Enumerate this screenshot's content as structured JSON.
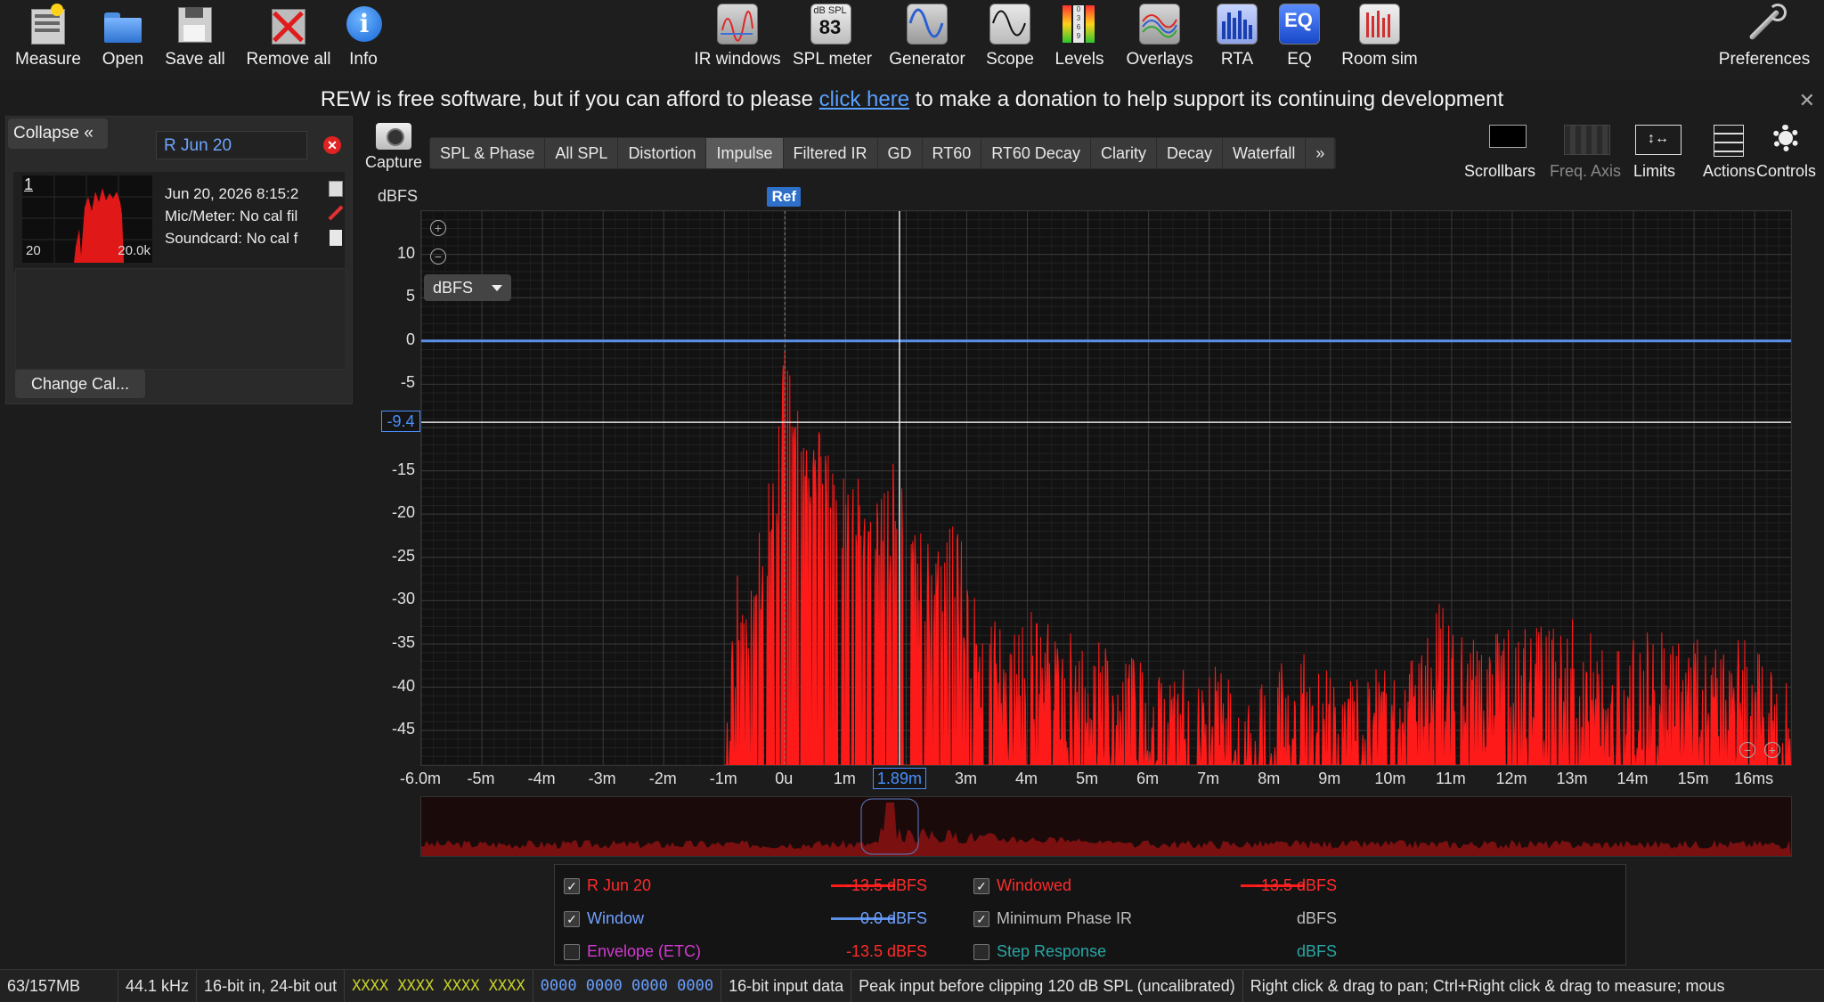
{
  "toolbar": {
    "left": [
      {
        "id": "measure",
        "label": "Measure",
        "icon": "measure-icon"
      },
      {
        "id": "open",
        "label": "Open",
        "icon": "folder-icon"
      },
      {
        "id": "save_all",
        "label": "Save all",
        "icon": "floppy-disk-icon"
      },
      {
        "id": "remove_all",
        "label": "Remove all",
        "icon": "remove-all-icon"
      },
      {
        "id": "info",
        "label": "Info",
        "icon": "info-icon"
      }
    ],
    "right": [
      {
        "id": "ir_windows",
        "label": "IR windows",
        "icon": "ir-windows-icon"
      },
      {
        "id": "spl_meter",
        "label": "SPL meter",
        "icon": "spl-meter-icon",
        "icon_text": "dB SPL",
        "icon_value": "83"
      },
      {
        "id": "generator",
        "label": "Generator",
        "icon": "sine-wave-icon"
      },
      {
        "id": "scope",
        "label": "Scope",
        "icon": "scope-icon"
      },
      {
        "id": "levels",
        "label": "Levels",
        "icon": "levels-icon"
      },
      {
        "id": "overlays",
        "label": "Overlays",
        "icon": "overlays-icon"
      },
      {
        "id": "rta",
        "label": "RTA",
        "icon": "rta-bars-icon"
      },
      {
        "id": "eq",
        "label": "EQ",
        "icon": "eq-icon",
        "icon_text": "EQ"
      },
      {
        "id": "room_sim",
        "label": "Room sim",
        "icon": "room-sim-icon"
      }
    ],
    "preferences": "Preferences"
  },
  "banner": {
    "before": "REW is free software, but if you can afford to please ",
    "link": "click here",
    "after": " to make a donation to help support its continuing development",
    "close": "✕"
  },
  "measurements_panel": {
    "collapse_label": "Collapse",
    "collapse_glyph": "«",
    "name": "R Jun 20",
    "index": "1",
    "thumb_left": "20",
    "thumb_right": "20.0k",
    "info_lines": [
      "Jun 20, 2026 8:15:2",
      "Mic/Meter: No cal fil",
      "Soundcard: No cal f"
    ],
    "change_cal": "Change Cal..."
  },
  "graph": {
    "capture_label": "Capture",
    "tabs": [
      {
        "label": "SPL & Phase",
        "active": false
      },
      {
        "label": "All SPL",
        "active": false
      },
      {
        "label": "Distortion",
        "active": false
      },
      {
        "label": "Impulse",
        "active": true
      },
      {
        "label": "Filtered IR",
        "active": false
      },
      {
        "label": "GD",
        "active": false
      },
      {
        "label": "RT60",
        "active": false
      },
      {
        "label": "RT60 Decay",
        "active": false
      },
      {
        "label": "Clarity",
        "active": false
      },
      {
        "label": "Decay",
        "active": false
      },
      {
        "label": "Waterfall",
        "active": false
      },
      {
        "label": "»",
        "active": false
      }
    ],
    "tools": [
      {
        "label": "Scrollbars",
        "dim": false
      },
      {
        "label": "Freq. Axis",
        "dim": true
      },
      {
        "label": "Limits",
        "dim": false
      },
      {
        "label": "Actions",
        "dim": false
      },
      {
        "label": "Controls",
        "dim": false
      }
    ],
    "y_unit": "dBFS",
    "unit_select": "dBFS",
    "ref_label": "Ref",
    "cursor_x": "1.89m",
    "cursor_y": "-9.4"
  },
  "chart_data": {
    "type": "line",
    "title": "",
    "xlabel": "",
    "ylabel": "dBFS",
    "x_unit": "ms",
    "xlim": [
      -6.0,
      16.6
    ],
    "ylim": [
      -49,
      15
    ],
    "grid": true,
    "y_ticks": [
      "10",
      "5",
      "0",
      "-5",
      "-9.4",
      "-15",
      "-20",
      "-25",
      "-30",
      "-35",
      "-40",
      "-45"
    ],
    "y_tick_values": [
      10,
      5,
      0,
      -5,
      -9.4,
      -15,
      -20,
      -25,
      -30,
      -35,
      -40,
      -45
    ],
    "x_ticks": [
      "-6.0m",
      "-5m",
      "-4m",
      "-3m",
      "-2m",
      "-1m",
      "0u",
      "1m",
      "1.89m",
      "3m",
      "4m",
      "5m",
      "6m",
      "7m",
      "8m",
      "9m",
      "10m",
      "11m",
      "12m",
      "13m",
      "14m",
      "15m",
      "16ms"
    ],
    "x_tick_values": [
      -6,
      -5,
      -4,
      -3,
      -2,
      -1,
      0,
      1,
      1.89,
      3,
      4,
      5,
      6,
      7,
      8,
      9,
      10,
      11,
      12,
      13,
      14,
      15,
      16
    ],
    "cursor": {
      "x": 1.89,
      "y": -9.4
    },
    "series": [
      {
        "name": "R Jun 20",
        "color": "#ff1a1a",
        "value_label": "-13.5 dBFS",
        "envelope": [
          [
            -1.0,
            -49
          ],
          [
            -0.8,
            -24
          ],
          [
            -0.6,
            -30
          ],
          [
            -0.4,
            -19
          ],
          [
            -0.2,
            -15
          ],
          [
            0.0,
            0
          ],
          [
            0.2,
            -7
          ],
          [
            0.4,
            -6
          ],
          [
            0.6,
            -9
          ],
          [
            0.8,
            -12
          ],
          [
            1.0,
            -12
          ],
          [
            1.2,
            -14
          ],
          [
            1.4,
            -16
          ],
          [
            1.6,
            -17
          ],
          [
            1.8,
            -13
          ],
          [
            1.95,
            -9
          ],
          [
            2.1,
            -18
          ],
          [
            2.4,
            -24
          ],
          [
            2.8,
            -21
          ],
          [
            3.2,
            -28
          ],
          [
            3.6,
            -33
          ],
          [
            4.0,
            -31
          ],
          [
            4.5,
            -33
          ],
          [
            5.0,
            -34
          ],
          [
            5.5,
            -36
          ],
          [
            6.0,
            -37
          ],
          [
            6.5,
            -38
          ],
          [
            7.0,
            -37
          ],
          [
            7.5,
            -40
          ],
          [
            8.0,
            -38
          ],
          [
            8.5,
            -36
          ],
          [
            9.0,
            -37
          ],
          [
            9.5,
            -38
          ],
          [
            10.0,
            -37
          ],
          [
            10.5,
            -36
          ],
          [
            10.8,
            -30
          ],
          [
            11.2,
            -33
          ],
          [
            11.6,
            -34
          ],
          [
            12.0,
            -32
          ],
          [
            12.5,
            -33
          ],
          [
            13.0,
            -32
          ],
          [
            13.5,
            -35
          ],
          [
            14.0,
            -34
          ],
          [
            14.5,
            -33
          ],
          [
            15.0,
            -34
          ],
          [
            15.5,
            -35
          ],
          [
            16.0,
            -34
          ],
          [
            16.6,
            -39
          ]
        ]
      },
      {
        "name": "Window",
        "color": "#5b8fe8",
        "value_label": "0.0 dBFS",
        "constant": 0
      }
    ]
  },
  "legend": {
    "rows": [
      {
        "checked": true,
        "name": "R Jun 20",
        "name_color": "#ff2b2b",
        "line_color": "#ff1a1a",
        "value": "-13.5 dBFS",
        "value_color": "#ff2b2b"
      },
      {
        "checked": true,
        "name": "Window",
        "name_color": "#6fa0ff",
        "line_color": "#5b8fe8",
        "value": "0.0 dBFS",
        "value_color": "#6fa0ff"
      },
      {
        "checked": false,
        "name": "Envelope (ETC)",
        "name_color": "#d23ad2",
        "line_color": "",
        "value": "-13.5 dBFS",
        "value_color": "#ff2b2b"
      },
      {
        "checked": true,
        "name": "Windowed",
        "name_color": "#ff2b2b",
        "line_color": "#ff1a1a",
        "value": "-13.5 dBFS",
        "value_color": "#ff2b2b"
      },
      {
        "checked": true,
        "name": "Minimum Phase IR",
        "name_color": "#bdbdbd",
        "line_color": "",
        "value": "dBFS",
        "value_color": "#bdbdbd"
      },
      {
        "checked": false,
        "name": "Step Response",
        "name_color": "#2aa6a6",
        "line_color": "",
        "value": "dBFS",
        "value_color": "#2aa6a6"
      }
    ]
  },
  "status_bar": {
    "memory": "63/157MB",
    "sample_rate": "44.1 kHz",
    "bit_depth": "16-bit in, 24-bit out",
    "input_bits_a": "XXXX XXXX  XXXX XXXX",
    "output_bits_a": "0000 0000  0000 0000",
    "input_data": "16-bit input data",
    "peak_input": "Peak input before clipping 120 dB SPL (uncalibrated)",
    "hint": "Right click & drag to pan; Ctrl+Right click & drag to measure; mous"
  }
}
